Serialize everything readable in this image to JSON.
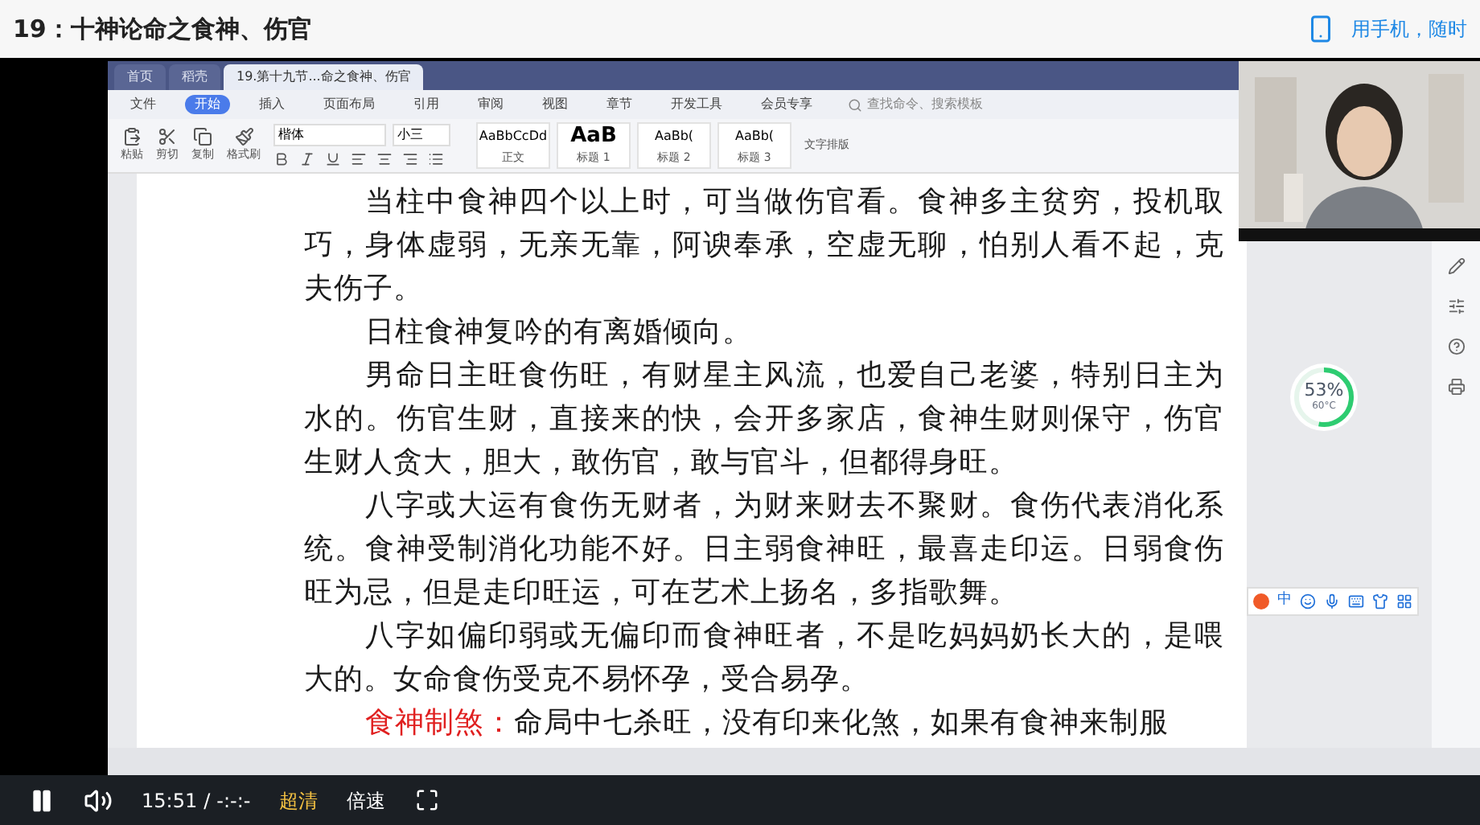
{
  "page": {
    "title": "19：十神论命之食神、伤官",
    "mobile_link": "用手机，随时"
  },
  "editor": {
    "tabs": [
      {
        "label": "首页",
        "selected": false
      },
      {
        "label": "稻壳",
        "selected": false
      },
      {
        "label": "19.第十九节...命之食神、伤官",
        "selected": true
      }
    ],
    "menu": [
      {
        "label": "文件",
        "selected": false
      },
      {
        "label": "开始",
        "selected": true
      },
      {
        "label": "插入",
        "selected": false
      },
      {
        "label": "页面布局",
        "selected": false
      },
      {
        "label": "引用",
        "selected": false
      },
      {
        "label": "审阅",
        "selected": false
      },
      {
        "label": "视图",
        "selected": false
      },
      {
        "label": "章节",
        "selected": false
      },
      {
        "label": "开发工具",
        "selected": false
      },
      {
        "label": "会员专享",
        "selected": false
      }
    ],
    "search": {
      "placeholder": "查找命令、搜索模板"
    },
    "clipboard": [
      "粘贴",
      "剪切",
      "复制",
      "格式刷"
    ],
    "font": {
      "family": "楷体",
      "size": "小三"
    },
    "styles": [
      {
        "sample": "AaBbCcDd",
        "label": "正文"
      },
      {
        "sample": "AaB",
        "label": "标题 1"
      },
      {
        "sample": "AaBb(",
        "label": "标题 2"
      },
      {
        "sample": "AaBb(",
        "label": "标题 3"
      }
    ],
    "layout_button": "文字排版",
    "paragraphs": [
      {
        "text": "当柱中食神四个以上时，可当做伤官看。食神多主贫穷，投机取巧，身体虚弱，无亲无靠，阿谀奉承，空虚无聊，怕别人看不起，克夫伤子。"
      },
      {
        "text": "日柱食神复吟的有离婚倾向。"
      },
      {
        "text": "男命日主旺食伤旺，有财星主风流，也爱自己老婆，特别日主为水的。伤官生财，直接来的快，会开多家店，食神生财则保守，伤官生财人贪大，胆大，敢伤官，敢与官斗，但都得身旺。"
      },
      {
        "text": "八字或大运有食伤无财者，为财来财去不聚财。食伤代表消化系统。食神受制消化功能不好。日主弱食神旺，最喜走印运。日弱食伤旺为忌，但是走印旺运，可在艺术上扬名，多指歌舞。"
      },
      {
        "text": "八字如偏印弱或无偏印而食神旺者，不是吃妈妈奶长大的，是喂大的。女命食伤受克不易怀孕，受合易孕。"
      },
      {
        "lead": "食神制煞：",
        "text": "命局中七杀旺，没有印来化煞，如果有食神来制服"
      }
    ],
    "gauge": {
      "reading": "53%",
      "temperature": "60°C",
      "level": 0.53
    },
    "ime": {
      "mode": "中"
    }
  },
  "player": {
    "playing": true,
    "time": "15:51",
    "separator": "/",
    "duration": "-:-:-",
    "quality": "超清",
    "speed": "倍速"
  }
}
